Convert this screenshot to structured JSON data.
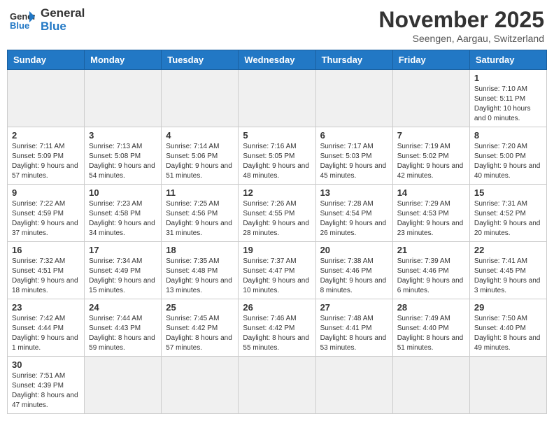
{
  "header": {
    "logo_general": "General",
    "logo_blue": "Blue",
    "month_title": "November 2025",
    "location": "Seengen, Aargau, Switzerland"
  },
  "days_of_week": [
    "Sunday",
    "Monday",
    "Tuesday",
    "Wednesday",
    "Thursday",
    "Friday",
    "Saturday"
  ],
  "weeks": [
    [
      {
        "day": "",
        "info": "",
        "empty": true
      },
      {
        "day": "",
        "info": "",
        "empty": true
      },
      {
        "day": "",
        "info": "",
        "empty": true
      },
      {
        "day": "",
        "info": "",
        "empty": true
      },
      {
        "day": "",
        "info": "",
        "empty": true
      },
      {
        "day": "",
        "info": "",
        "empty": true
      },
      {
        "day": "1",
        "info": "Sunrise: 7:10 AM\nSunset: 5:11 PM\nDaylight: 10 hours\nand 0 minutes."
      }
    ],
    [
      {
        "day": "2",
        "info": "Sunrise: 7:11 AM\nSunset: 5:09 PM\nDaylight: 9 hours\nand 57 minutes."
      },
      {
        "day": "3",
        "info": "Sunrise: 7:13 AM\nSunset: 5:08 PM\nDaylight: 9 hours\nand 54 minutes."
      },
      {
        "day": "4",
        "info": "Sunrise: 7:14 AM\nSunset: 5:06 PM\nDaylight: 9 hours\nand 51 minutes."
      },
      {
        "day": "5",
        "info": "Sunrise: 7:16 AM\nSunset: 5:05 PM\nDaylight: 9 hours\nand 48 minutes."
      },
      {
        "day": "6",
        "info": "Sunrise: 7:17 AM\nSunset: 5:03 PM\nDaylight: 9 hours\nand 45 minutes."
      },
      {
        "day": "7",
        "info": "Sunrise: 7:19 AM\nSunset: 5:02 PM\nDaylight: 9 hours\nand 42 minutes."
      },
      {
        "day": "8",
        "info": "Sunrise: 7:20 AM\nSunset: 5:00 PM\nDaylight: 9 hours\nand 40 minutes."
      }
    ],
    [
      {
        "day": "9",
        "info": "Sunrise: 7:22 AM\nSunset: 4:59 PM\nDaylight: 9 hours\nand 37 minutes."
      },
      {
        "day": "10",
        "info": "Sunrise: 7:23 AM\nSunset: 4:58 PM\nDaylight: 9 hours\nand 34 minutes."
      },
      {
        "day": "11",
        "info": "Sunrise: 7:25 AM\nSunset: 4:56 PM\nDaylight: 9 hours\nand 31 minutes."
      },
      {
        "day": "12",
        "info": "Sunrise: 7:26 AM\nSunset: 4:55 PM\nDaylight: 9 hours\nand 28 minutes."
      },
      {
        "day": "13",
        "info": "Sunrise: 7:28 AM\nSunset: 4:54 PM\nDaylight: 9 hours\nand 26 minutes."
      },
      {
        "day": "14",
        "info": "Sunrise: 7:29 AM\nSunset: 4:53 PM\nDaylight: 9 hours\nand 23 minutes."
      },
      {
        "day": "15",
        "info": "Sunrise: 7:31 AM\nSunset: 4:52 PM\nDaylight: 9 hours\nand 20 minutes."
      }
    ],
    [
      {
        "day": "16",
        "info": "Sunrise: 7:32 AM\nSunset: 4:51 PM\nDaylight: 9 hours\nand 18 minutes."
      },
      {
        "day": "17",
        "info": "Sunrise: 7:34 AM\nSunset: 4:49 PM\nDaylight: 9 hours\nand 15 minutes."
      },
      {
        "day": "18",
        "info": "Sunrise: 7:35 AM\nSunset: 4:48 PM\nDaylight: 9 hours\nand 13 minutes."
      },
      {
        "day": "19",
        "info": "Sunrise: 7:37 AM\nSunset: 4:47 PM\nDaylight: 9 hours\nand 10 minutes."
      },
      {
        "day": "20",
        "info": "Sunrise: 7:38 AM\nSunset: 4:46 PM\nDaylight: 9 hours\nand 8 minutes."
      },
      {
        "day": "21",
        "info": "Sunrise: 7:39 AM\nSunset: 4:46 PM\nDaylight: 9 hours\nand 6 minutes."
      },
      {
        "day": "22",
        "info": "Sunrise: 7:41 AM\nSunset: 4:45 PM\nDaylight: 9 hours\nand 3 minutes."
      }
    ],
    [
      {
        "day": "23",
        "info": "Sunrise: 7:42 AM\nSunset: 4:44 PM\nDaylight: 9 hours\nand 1 minute."
      },
      {
        "day": "24",
        "info": "Sunrise: 7:44 AM\nSunset: 4:43 PM\nDaylight: 8 hours\nand 59 minutes."
      },
      {
        "day": "25",
        "info": "Sunrise: 7:45 AM\nSunset: 4:42 PM\nDaylight: 8 hours\nand 57 minutes."
      },
      {
        "day": "26",
        "info": "Sunrise: 7:46 AM\nSunset: 4:42 PM\nDaylight: 8 hours\nand 55 minutes."
      },
      {
        "day": "27",
        "info": "Sunrise: 7:48 AM\nSunset: 4:41 PM\nDaylight: 8 hours\nand 53 minutes."
      },
      {
        "day": "28",
        "info": "Sunrise: 7:49 AM\nSunset: 4:40 PM\nDaylight: 8 hours\nand 51 minutes."
      },
      {
        "day": "29",
        "info": "Sunrise: 7:50 AM\nSunset: 4:40 PM\nDaylight: 8 hours\nand 49 minutes."
      }
    ],
    [
      {
        "day": "30",
        "info": "Sunrise: 7:51 AM\nSunset: 4:39 PM\nDaylight: 8 hours\nand 47 minutes."
      },
      {
        "day": "",
        "info": "",
        "empty": true
      },
      {
        "day": "",
        "info": "",
        "empty": true
      },
      {
        "day": "",
        "info": "",
        "empty": true
      },
      {
        "day": "",
        "info": "",
        "empty": true
      },
      {
        "day": "",
        "info": "",
        "empty": true
      },
      {
        "day": "",
        "info": "",
        "empty": true
      }
    ]
  ]
}
